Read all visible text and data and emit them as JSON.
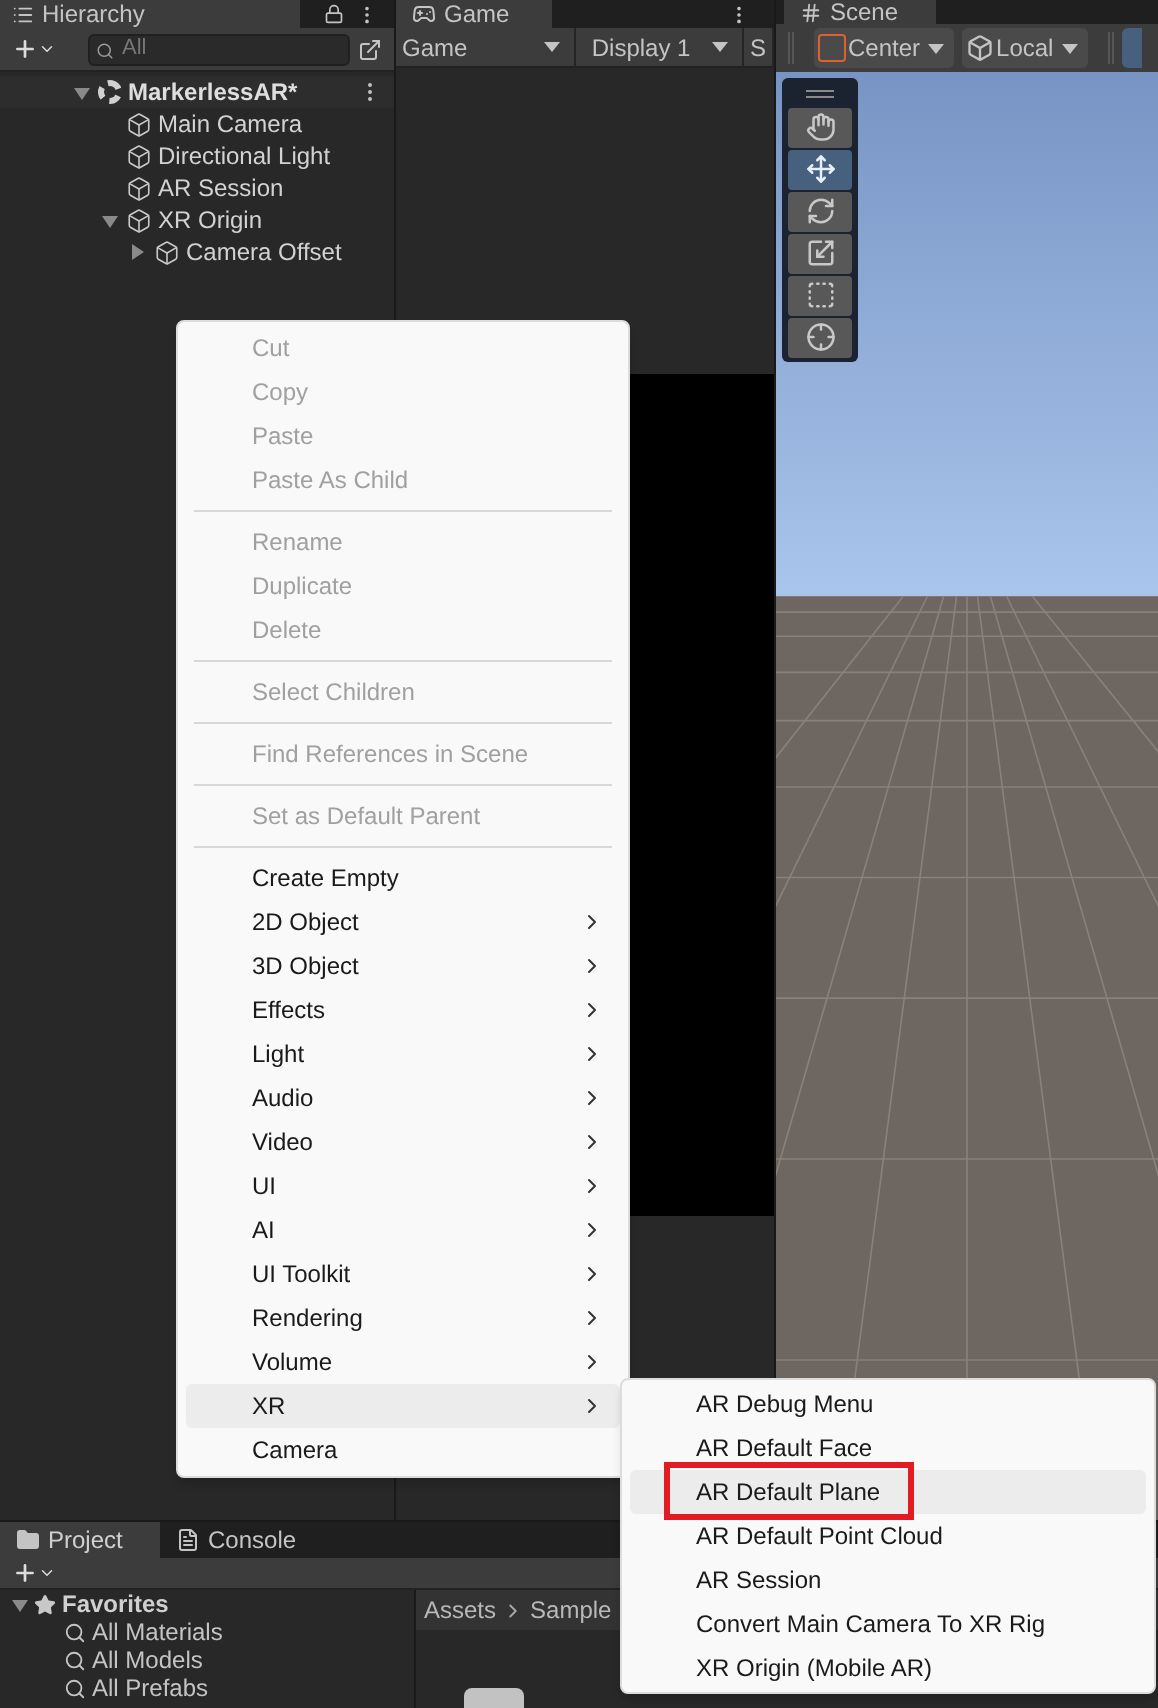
{
  "hierarchy": {
    "tab": "Hierarchy",
    "search": {
      "placeholder": "All"
    },
    "tree": [
      {
        "label": "MarkerlessAR*",
        "kind": "scene",
        "expanded": true,
        "children": [
          {
            "label": "Main Camera",
            "kind": "object"
          },
          {
            "label": "Directional Light",
            "kind": "object"
          },
          {
            "label": "AR Session",
            "kind": "object"
          },
          {
            "label": "XR Origin",
            "kind": "object",
            "expanded": true,
            "children": [
              {
                "label": "Camera Offset",
                "kind": "object",
                "expanded": false
              }
            ]
          }
        ]
      }
    ]
  },
  "game": {
    "tab": "Game",
    "toolbar": [
      "Game",
      "Display 1",
      "S"
    ]
  },
  "scene": {
    "tab": "Scene",
    "toolbar": [
      "Center",
      "Local"
    ],
    "tools": [
      {
        "kind": "hand",
        "selected": false
      },
      {
        "kind": "move",
        "selected": true
      },
      {
        "kind": "rotate",
        "selected": false
      },
      {
        "kind": "scale",
        "selected": false
      },
      {
        "kind": "rect",
        "selected": false
      },
      {
        "kind": "transform",
        "selected": false
      }
    ]
  },
  "context_menu": [
    {
      "kind": "item",
      "label": "Cut",
      "disabled": true,
      "submenu": false,
      "selected": false
    },
    {
      "kind": "item",
      "label": "Copy",
      "disabled": true,
      "submenu": false,
      "selected": false
    },
    {
      "kind": "item",
      "label": "Paste",
      "disabled": true,
      "submenu": false,
      "selected": false
    },
    {
      "kind": "item",
      "label": "Paste As Child",
      "disabled": true,
      "submenu": false,
      "selected": false
    },
    {
      "kind": "separator"
    },
    {
      "kind": "item",
      "label": "Rename",
      "disabled": true,
      "submenu": false,
      "selected": false
    },
    {
      "kind": "item",
      "label": "Duplicate",
      "disabled": true,
      "submenu": false,
      "selected": false
    },
    {
      "kind": "item",
      "label": "Delete",
      "disabled": true,
      "submenu": false,
      "selected": false
    },
    {
      "kind": "separator"
    },
    {
      "kind": "item",
      "label": "Select Children",
      "disabled": true,
      "submenu": false,
      "selected": false
    },
    {
      "kind": "separator"
    },
    {
      "kind": "item",
      "label": "Find References in Scene",
      "disabled": true,
      "submenu": false,
      "selected": false
    },
    {
      "kind": "separator"
    },
    {
      "kind": "item",
      "label": "Set as Default Parent",
      "disabled": true,
      "submenu": false,
      "selected": false
    },
    {
      "kind": "separator"
    },
    {
      "kind": "item",
      "label": "Create Empty",
      "disabled": false,
      "submenu": false,
      "selected": false
    },
    {
      "kind": "item",
      "label": "2D Object",
      "disabled": false,
      "submenu": true,
      "selected": false
    },
    {
      "kind": "item",
      "label": "3D Object",
      "disabled": false,
      "submenu": true,
      "selected": false
    },
    {
      "kind": "item",
      "label": "Effects",
      "disabled": false,
      "submenu": true,
      "selected": false
    },
    {
      "kind": "item",
      "label": "Light",
      "disabled": false,
      "submenu": true,
      "selected": false
    },
    {
      "kind": "item",
      "label": "Audio",
      "disabled": false,
      "submenu": true,
      "selected": false
    },
    {
      "kind": "item",
      "label": "Video",
      "disabled": false,
      "submenu": true,
      "selected": false
    },
    {
      "kind": "item",
      "label": "UI",
      "disabled": false,
      "submenu": true,
      "selected": false
    },
    {
      "kind": "item",
      "label": "AI",
      "disabled": false,
      "submenu": true,
      "selected": false
    },
    {
      "kind": "item",
      "label": "UI Toolkit",
      "disabled": false,
      "submenu": true,
      "selected": false
    },
    {
      "kind": "item",
      "label": "Rendering",
      "disabled": false,
      "submenu": true,
      "selected": false
    },
    {
      "kind": "item",
      "label": "Volume",
      "disabled": false,
      "submenu": true,
      "selected": false
    },
    {
      "kind": "item",
      "label": "XR",
      "disabled": false,
      "submenu": true,
      "selected": true
    },
    {
      "kind": "item",
      "label": "Camera",
      "disabled": false,
      "submenu": false,
      "selected": false
    }
  ],
  "submenu": [
    {
      "label": "AR Debug Menu",
      "selected": false,
      "annotated": false
    },
    {
      "label": "AR Default Face",
      "selected": false,
      "annotated": false
    },
    {
      "label": "AR Default Plane",
      "selected": true,
      "annotated": true
    },
    {
      "label": "AR Default Point Cloud",
      "selected": false,
      "annotated": false
    },
    {
      "label": "AR Session",
      "selected": false,
      "annotated": false
    },
    {
      "label": "Convert Main Camera To XR Rig",
      "selected": false,
      "annotated": false
    },
    {
      "label": "XR Origin (Mobile AR)",
      "selected": false,
      "annotated": false
    }
  ],
  "project": {
    "tabs": [
      {
        "label": "Project",
        "kind": "project",
        "selected": true
      },
      {
        "label": "Console",
        "kind": "console",
        "selected": false
      }
    ],
    "favorites": {
      "label": "Favorites",
      "expanded": true,
      "items": [
        "All Materials",
        "All Models",
        "All Prefabs"
      ]
    },
    "breadcrumb": [
      "Assets",
      "Sample"
    ]
  }
}
